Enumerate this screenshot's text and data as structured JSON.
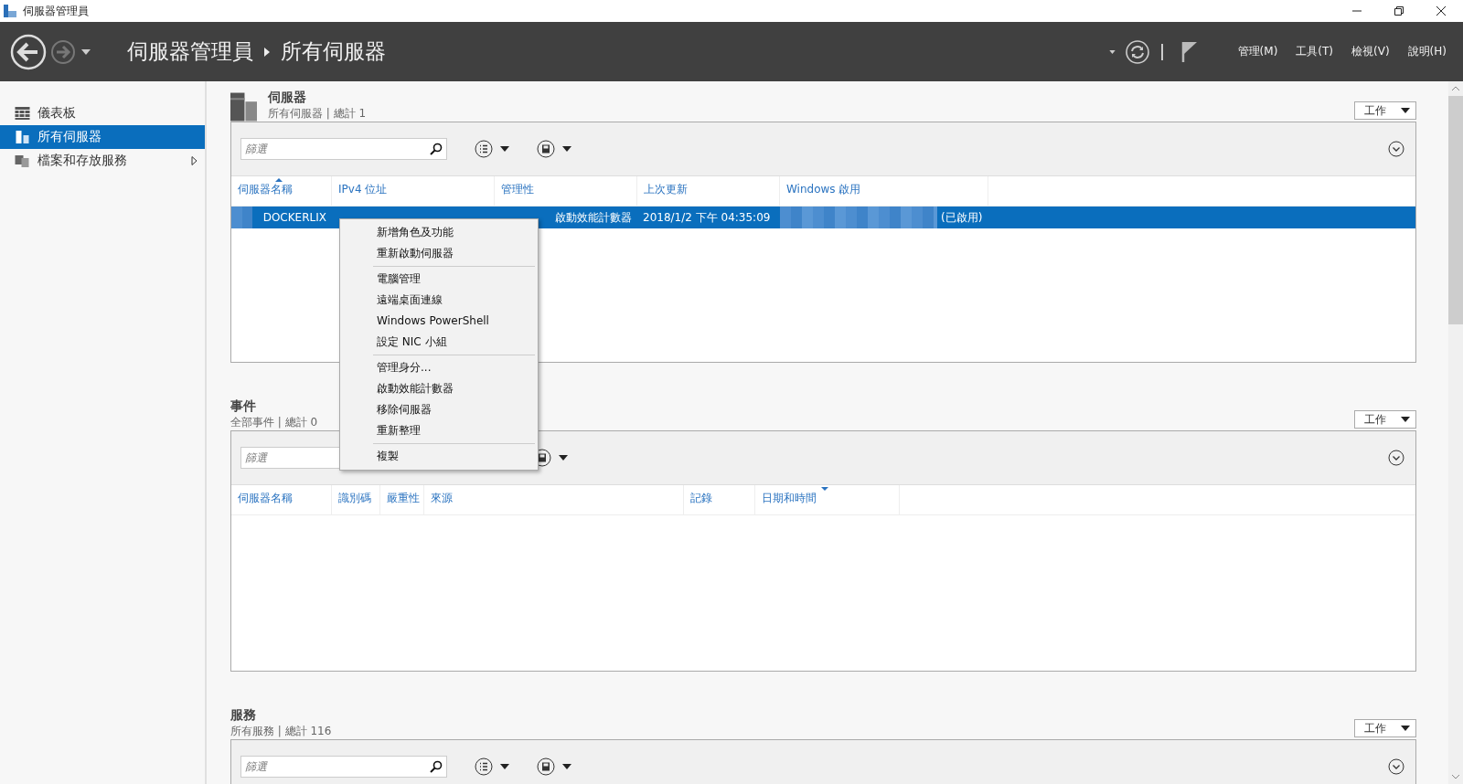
{
  "window": {
    "title": "伺服器管理員"
  },
  "header": {
    "breadcrumb": [
      "伺服器管理員",
      "所有伺服器"
    ],
    "menus": [
      "管理(M)",
      "工具(T)",
      "檢視(V)",
      "說明(H)"
    ]
  },
  "sidebar": {
    "items": [
      {
        "label": "儀表板",
        "kind": "dashboard",
        "selected": false,
        "expandable": false
      },
      {
        "label": "所有伺服器",
        "kind": "servers",
        "selected": true,
        "expandable": false
      },
      {
        "label": "檔案和存放服務",
        "kind": "storage",
        "selected": false,
        "expandable": true
      }
    ]
  },
  "sections": [
    {
      "kind": "servers",
      "title": "伺服器",
      "subtitle": "所有伺服器 | 總計 1",
      "task_button": "工作",
      "filter": {
        "placeholder": "篩選"
      },
      "columns": [
        {
          "label": "伺服器名稱",
          "sorted": true,
          "descending": false
        },
        {
          "label": "IPv4 位址",
          "sorted": false
        },
        {
          "label": "管理性",
          "sorted": false
        },
        {
          "label": "上次更新",
          "sorted": false
        },
        {
          "label": "Windows 啟用",
          "sorted": false
        }
      ],
      "rows": [
        {
          "selected": true,
          "cells": [
            "DOCKERLIX",
            "",
            "啟動效能計數器",
            "2018/1/2 下午 04:35:09",
            "(已啟用)"
          ]
        }
      ]
    },
    {
      "kind": "events",
      "title": "事件",
      "subtitle": "全部事件 | 總計 0",
      "task_button": "工作",
      "filter": {
        "placeholder": "篩選"
      },
      "columns": [
        {
          "label": "伺服器名稱",
          "sorted": false
        },
        {
          "label": "識別碼",
          "sorted": false
        },
        {
          "label": "嚴重性",
          "sorted": false
        },
        {
          "label": "來源",
          "sorted": false
        },
        {
          "label": "記錄",
          "sorted": false
        },
        {
          "label": "日期和時間",
          "sorted": true,
          "descending": true
        }
      ]
    },
    {
      "kind": "services",
      "title": "服務",
      "subtitle": "所有服務 | 總計 116",
      "task_button": "工作",
      "filter": {
        "placeholder": "篩選"
      }
    }
  ],
  "context_menu": {
    "groups": [
      [
        "新增角色及功能",
        "重新啟動伺服器"
      ],
      [
        "電腦管理",
        "遠端桌面連線",
        "Windows PowerShell",
        "設定 NIC 小組"
      ],
      [
        "管理身分...",
        "啟動效能計數器",
        "移除伺服器",
        "重新整理"
      ],
      [
        "複製"
      ]
    ]
  }
}
